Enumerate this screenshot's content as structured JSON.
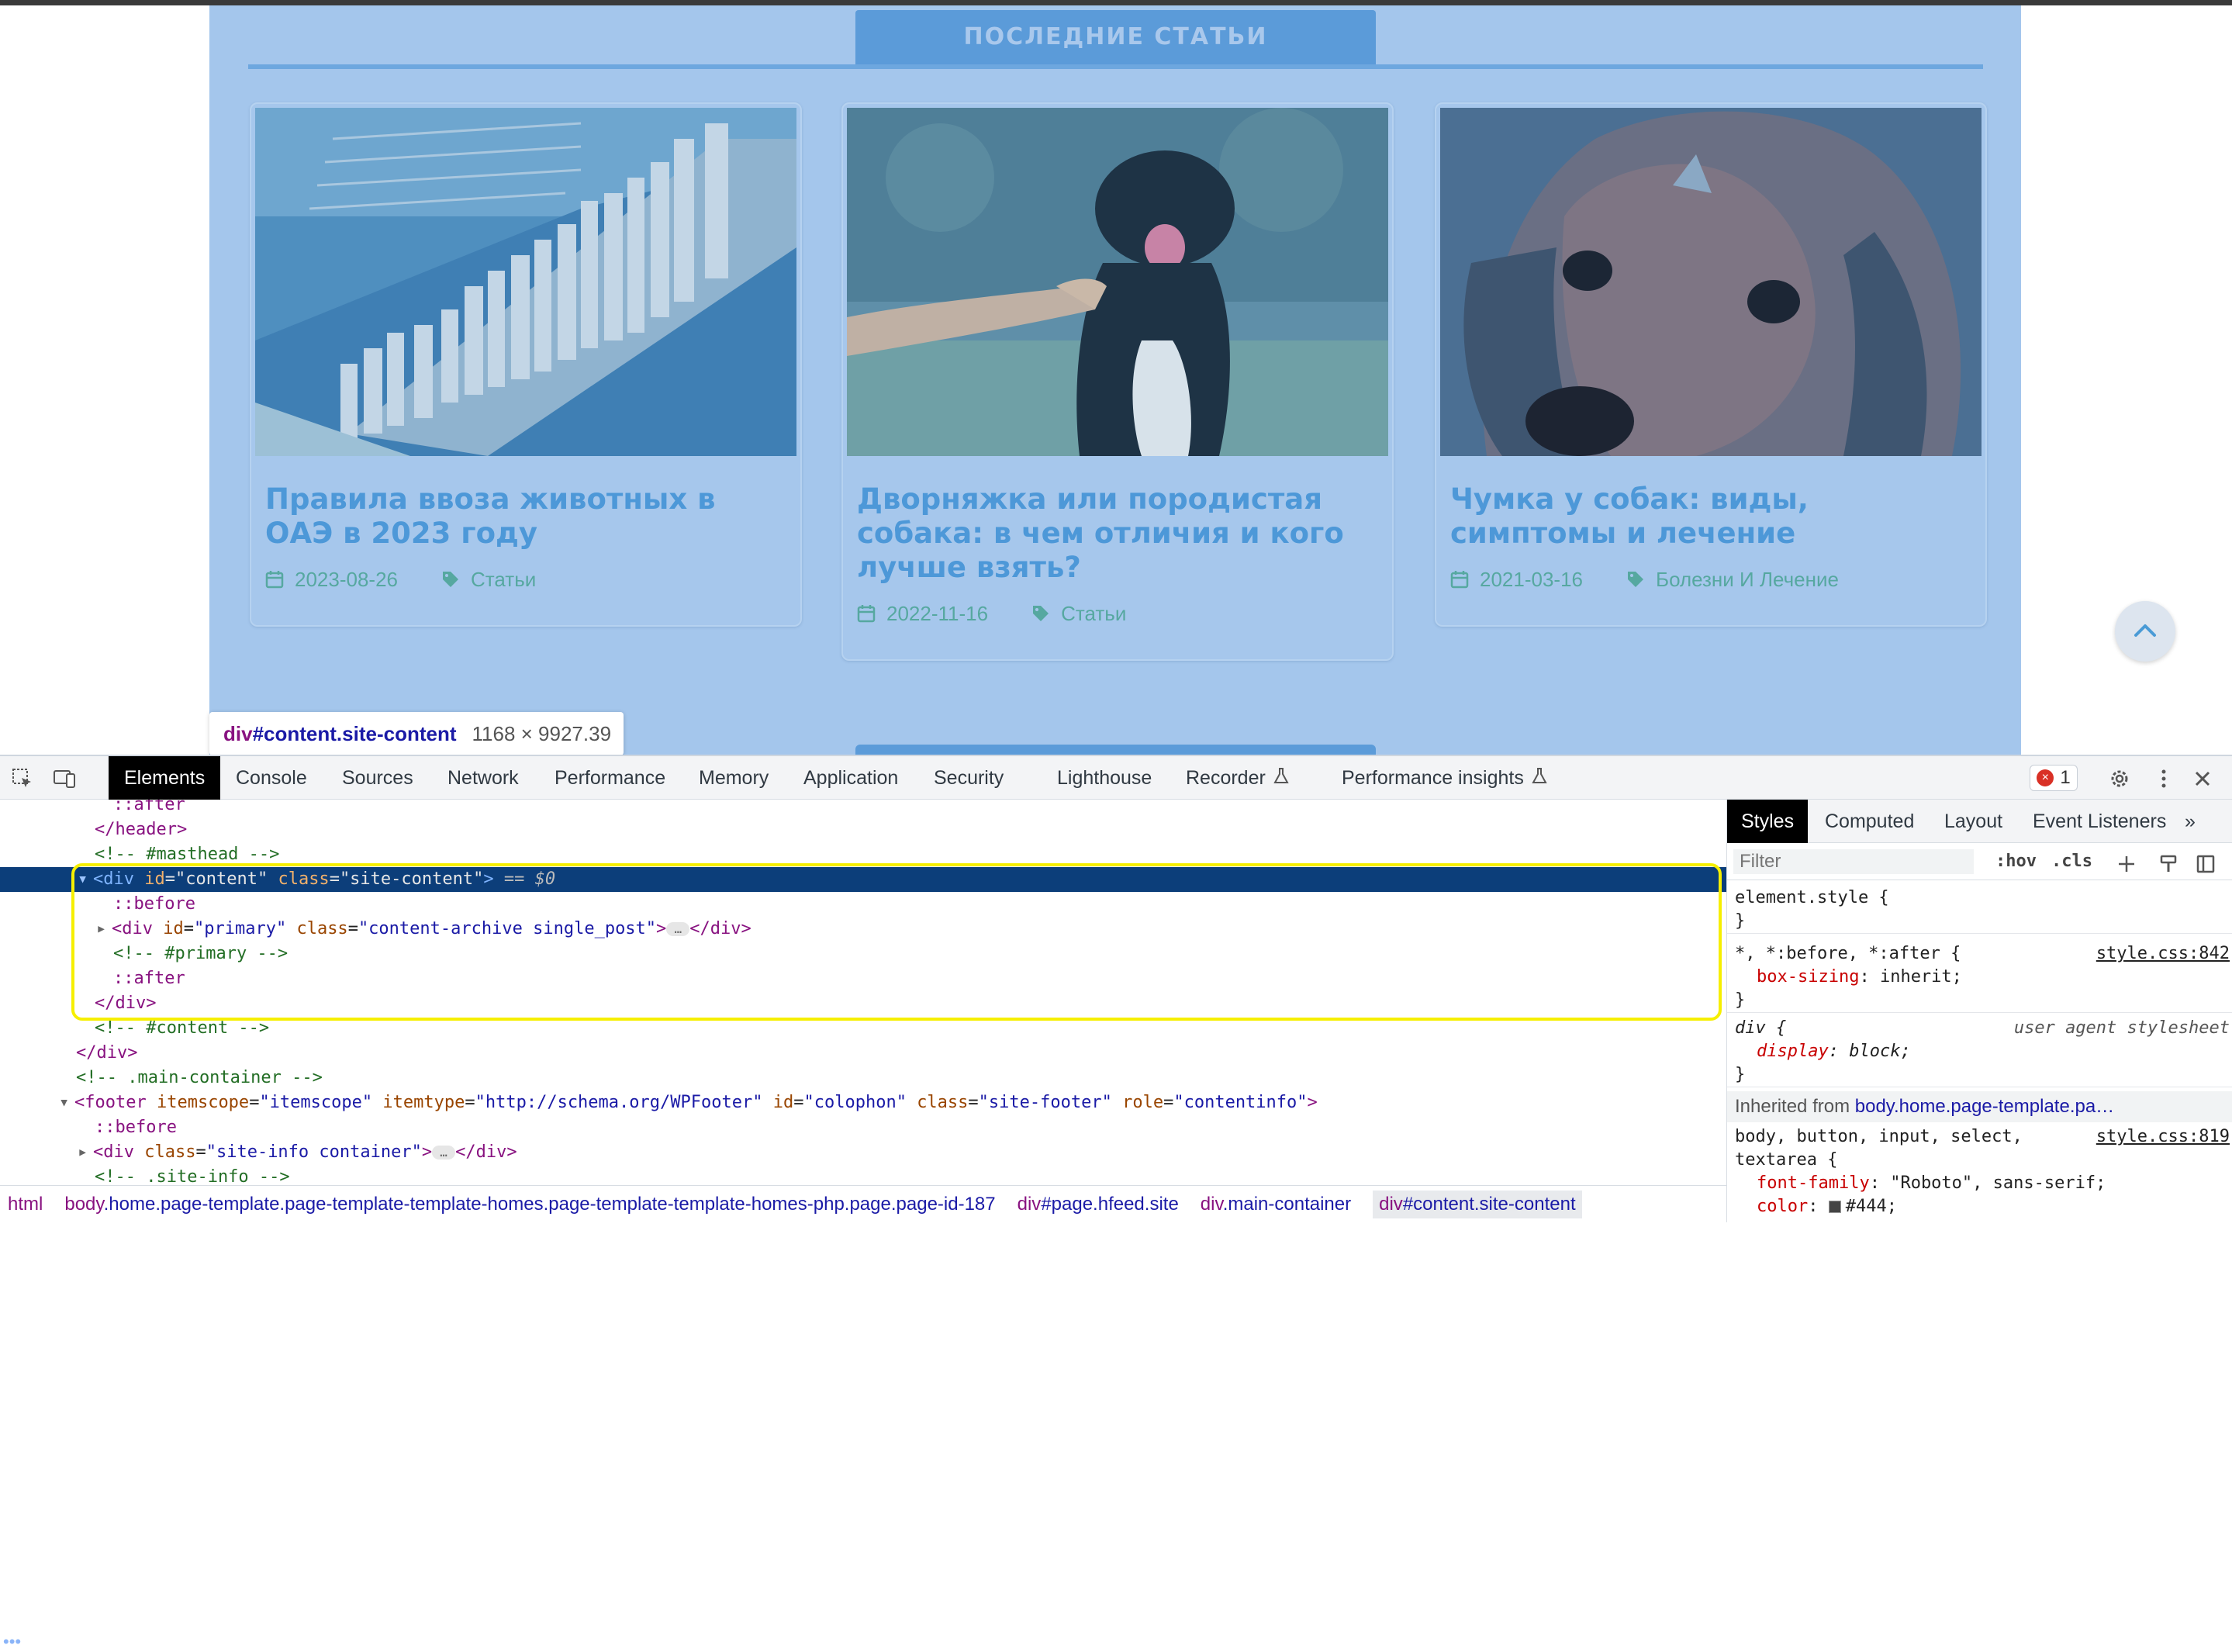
{
  "page": {
    "section_title": "ПОСЛЕДНИЕ СТАТЬИ",
    "articles": [
      {
        "title": "Правила ввоза животных в ОАЭ в 2023 году",
        "date": "2023-08-26",
        "category": "Статьи",
        "image": "dubai-marina-aerial"
      },
      {
        "title": "Дворняжка или породистая собака: в чем отличия и кого лучше взять?",
        "date": "2022-11-16",
        "category": "Статьи",
        "image": "dog-giving-paw"
      },
      {
        "title": "Чумка у собак: виды, симптомы и лечение",
        "date": "2021-03-16",
        "category": "Болезни И Лечение",
        "image": "beagle-closeup"
      }
    ],
    "scroll_top_icon": "chevron-up-icon"
  },
  "inspect_tooltip": {
    "tag": "div",
    "id_class": "#content.site-content",
    "dims": "1168 × 9927.39"
  },
  "devtools": {
    "tabs": [
      "Elements",
      "Console",
      "Sources",
      "Network",
      "Performance",
      "Memory",
      "Application",
      "Security",
      "Lighthouse",
      "Recorder",
      "Performance insights"
    ],
    "active_tab": "Elements",
    "error_count": "1",
    "dom_lines": {
      "l0": "::after",
      "l1_tag": "</header>",
      "l2": "<!-- #masthead -->",
      "l3_open": "<div",
      "l3_a1": "id",
      "l3_v1": "\"content\"",
      "l3_a2": "class",
      "l3_v2": "\"site-content\"",
      "l3_close": ">",
      "l3_eq": "== $0",
      "l4": "::before",
      "l5_open": "<div",
      "l5_a1": "id",
      "l5_v1": "\"primary\"",
      "l5_a2": "class",
      "l5_v2": "\"content-archive single_post\"",
      "l5_close": "</div>",
      "l6": "<!-- #primary -->",
      "l7": "::after",
      "l8": "</div>",
      "l9": "<!-- #content -->",
      "l10": "</div>",
      "l11": "<!-- .main-container -->",
      "l12_open": "<footer",
      "l12_a1": "itemscope",
      "l12_v1": "\"itemscope\"",
      "l12_a2": "itemtype",
      "l12_v2": "\"http://schema.org/WPFooter\"",
      "l12_a3": "id",
      "l12_v3": "\"colophon\"",
      "l12_a4": "class",
      "l12_v4": "\"site-footer\"",
      "l12_a5": "role",
      "l12_v5": "\"contentinfo\"",
      "l13": "::before",
      "l14_open": "<div",
      "l14_a1": "class",
      "l14_v1": "\"site-info container\"",
      "l14_close": "</div>",
      "l15": "<!-- .site-info -->"
    },
    "breadcrumbs": {
      "c1": "html",
      "c2_tag": "body",
      "c2_rest": ".home.page-template.page-template-template-homes.page-template-template-homes-php.page.page-id-187",
      "c3_tag": "div",
      "c3_rest": "#page.hfeed.site",
      "c4_tag": "div",
      "c4_rest": ".main-container",
      "c5_tag": "div",
      "c5_rest": "#content.site-content"
    },
    "styles": {
      "tabs": [
        "Styles",
        "Computed",
        "Layout",
        "Event Listeners"
      ],
      "filter_placeholder": "Filter",
      "hov": ":hov",
      "cls": ".cls",
      "r1_sel": "element.style {",
      "r1_close": "}",
      "r2_sel": "*, *:before, *:after {",
      "r2_src": "style.css:842",
      "r2_prop": "box-sizing",
      "r2_val": "inherit;",
      "r2_close": "}",
      "r3_sel": "div {",
      "r3_src": "user agent stylesheet",
      "r3_prop": "display",
      "r3_val": "block;",
      "r3_close": "}",
      "inherited_label": "Inherited from",
      "inherited_link": "body.home.page-template.pa…",
      "r4_sel1": "body, button, input, select,",
      "r4_src": "style.css:819",
      "r4_sel2": "textarea {",
      "r4_prop1": "font-family",
      "r4_val1": "\"Roboto\", sans-serif;",
      "r4_prop2": "color",
      "r4_val2": "#444;"
    }
  }
}
